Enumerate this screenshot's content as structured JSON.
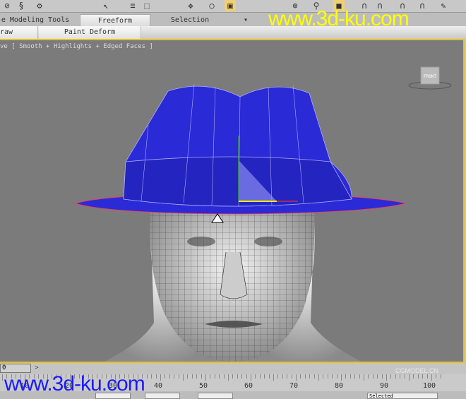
{
  "ribbon": {
    "tabs": [
      {
        "label": "e Modeling Tools"
      },
      {
        "label": "Freeform",
        "active": true
      },
      {
        "label": "Selection"
      }
    ],
    "subtabs": [
      {
        "label": "raw"
      },
      {
        "label": "Paint Deform"
      }
    ]
  },
  "viewport": {
    "label": "ve [ Smooth + Highlights + Edged Faces ]",
    "viewcube": "FRONT",
    "colors": {
      "border": "#e8c21c",
      "hat": "#2a2ad6",
      "background": "#7b7b7b"
    }
  },
  "watermarks": {
    "top": "www.3d-ku.com",
    "bottom": "www.3d-ku.com",
    "corner": "CGMODEL.CN"
  },
  "timeslider": {
    "frame": "0",
    "next": ">"
  },
  "ruler": {
    "labels": [
      "10",
      "20",
      "30",
      "40",
      "50",
      "60",
      "70",
      "80",
      "90",
      "100"
    ]
  },
  "status": {
    "selected": "Selected"
  }
}
